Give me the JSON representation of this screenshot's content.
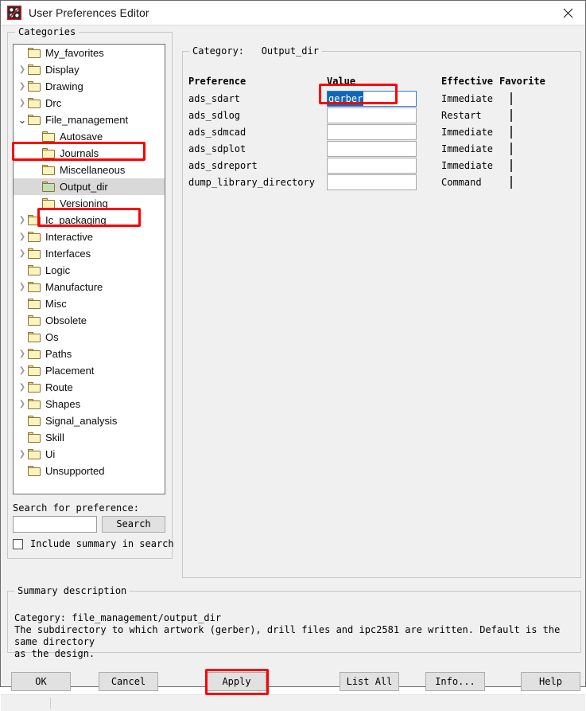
{
  "window": {
    "title": "User Preferences Editor",
    "icon": "app-dice-icon",
    "close_label": "✕"
  },
  "categories_panel": {
    "legend": "Categories",
    "tree": [
      {
        "label": "My_favorites",
        "depth": 1,
        "twisty": "none",
        "selected": false
      },
      {
        "label": "Display",
        "depth": 1,
        "twisty": "collapsed",
        "selected": false
      },
      {
        "label": "Drawing",
        "depth": 1,
        "twisty": "collapsed",
        "selected": false
      },
      {
        "label": "Drc",
        "depth": 1,
        "twisty": "collapsed",
        "selected": false
      },
      {
        "label": "File_management",
        "depth": 1,
        "twisty": "expanded",
        "selected": false
      },
      {
        "label": "Autosave",
        "depth": 2,
        "twisty": "none",
        "selected": false
      },
      {
        "label": "Journals",
        "depth": 2,
        "twisty": "none",
        "selected": false
      },
      {
        "label": "Miscellaneous",
        "depth": 2,
        "twisty": "none",
        "selected": false
      },
      {
        "label": "Output_dir",
        "depth": 2,
        "twisty": "none",
        "selected": true
      },
      {
        "label": "Versioning",
        "depth": 2,
        "twisty": "none",
        "selected": false
      },
      {
        "label": "Ic_packaging",
        "depth": 1,
        "twisty": "collapsed",
        "selected": false
      },
      {
        "label": "Interactive",
        "depth": 1,
        "twisty": "collapsed",
        "selected": false
      },
      {
        "label": "Interfaces",
        "depth": 1,
        "twisty": "collapsed",
        "selected": false
      },
      {
        "label": "Logic",
        "depth": 1,
        "twisty": "none",
        "selected": false
      },
      {
        "label": "Manufacture",
        "depth": 1,
        "twisty": "collapsed",
        "selected": false
      },
      {
        "label": "Misc",
        "depth": 1,
        "twisty": "none",
        "selected": false
      },
      {
        "label": "Obsolete",
        "depth": 1,
        "twisty": "none",
        "selected": false
      },
      {
        "label": "Os",
        "depth": 1,
        "twisty": "none",
        "selected": false
      },
      {
        "label": "Paths",
        "depth": 1,
        "twisty": "collapsed",
        "selected": false
      },
      {
        "label": "Placement",
        "depth": 1,
        "twisty": "collapsed",
        "selected": false
      },
      {
        "label": "Route",
        "depth": 1,
        "twisty": "collapsed",
        "selected": false
      },
      {
        "label": "Shapes",
        "depth": 1,
        "twisty": "collapsed",
        "selected": false
      },
      {
        "label": "Signal_analysis",
        "depth": 1,
        "twisty": "none",
        "selected": false
      },
      {
        "label": "Skill",
        "depth": 1,
        "twisty": "none",
        "selected": false
      },
      {
        "label": "Ui",
        "depth": 1,
        "twisty": "collapsed",
        "selected": false
      },
      {
        "label": "Unsupported",
        "depth": 1,
        "twisty": "none",
        "selected": false
      }
    ],
    "search_label": "Search for preference:",
    "search_value": "",
    "search_placeholder": "",
    "search_button": "Search",
    "include_summary_label": "Include summary in search",
    "include_summary_checked": false
  },
  "category_panel": {
    "legend": "Category:   Output_dir",
    "columns": {
      "preference": "Preference",
      "value": "Value",
      "effective": "Effective",
      "favorite": "Favorite"
    },
    "rows": [
      {
        "preference": "ads_sdart",
        "value": "gerber",
        "effective": "Immediate",
        "favorite": false,
        "focused": true,
        "selected_text": true
      },
      {
        "preference": "ads_sdlog",
        "value": "",
        "effective": "Restart",
        "favorite": false,
        "focused": false,
        "selected_text": false
      },
      {
        "preference": "ads_sdmcad",
        "value": "",
        "effective": "Immediate",
        "favorite": false,
        "focused": false,
        "selected_text": false
      },
      {
        "preference": "ads_sdplot",
        "value": "",
        "effective": "Immediate",
        "favorite": false,
        "focused": false,
        "selected_text": false
      },
      {
        "preference": "ads_sdreport",
        "value": "",
        "effective": "Immediate",
        "favorite": false,
        "focused": false,
        "selected_text": false
      },
      {
        "preference": "dump_library_directory",
        "value": "",
        "effective": "Command",
        "favorite": false,
        "focused": false,
        "selected_text": false
      }
    ]
  },
  "summary": {
    "legend": "Summary description",
    "text": "Category: file_management/output_dir\nThe subdirectory to which artwork (gerber), drill files and ipc2581 are written. Default is the same directory\nas the design."
  },
  "buttons": {
    "ok": "OK",
    "cancel": "Cancel",
    "apply": "Apply",
    "list_all": "List All",
    "info": "Info...",
    "help": "Help"
  },
  "annotations": {
    "color": "#ff0000",
    "targets": [
      "File_management",
      "Output_dir",
      "ads_sdart value field",
      "Apply"
    ]
  },
  "statusbar": {
    "text": ""
  }
}
